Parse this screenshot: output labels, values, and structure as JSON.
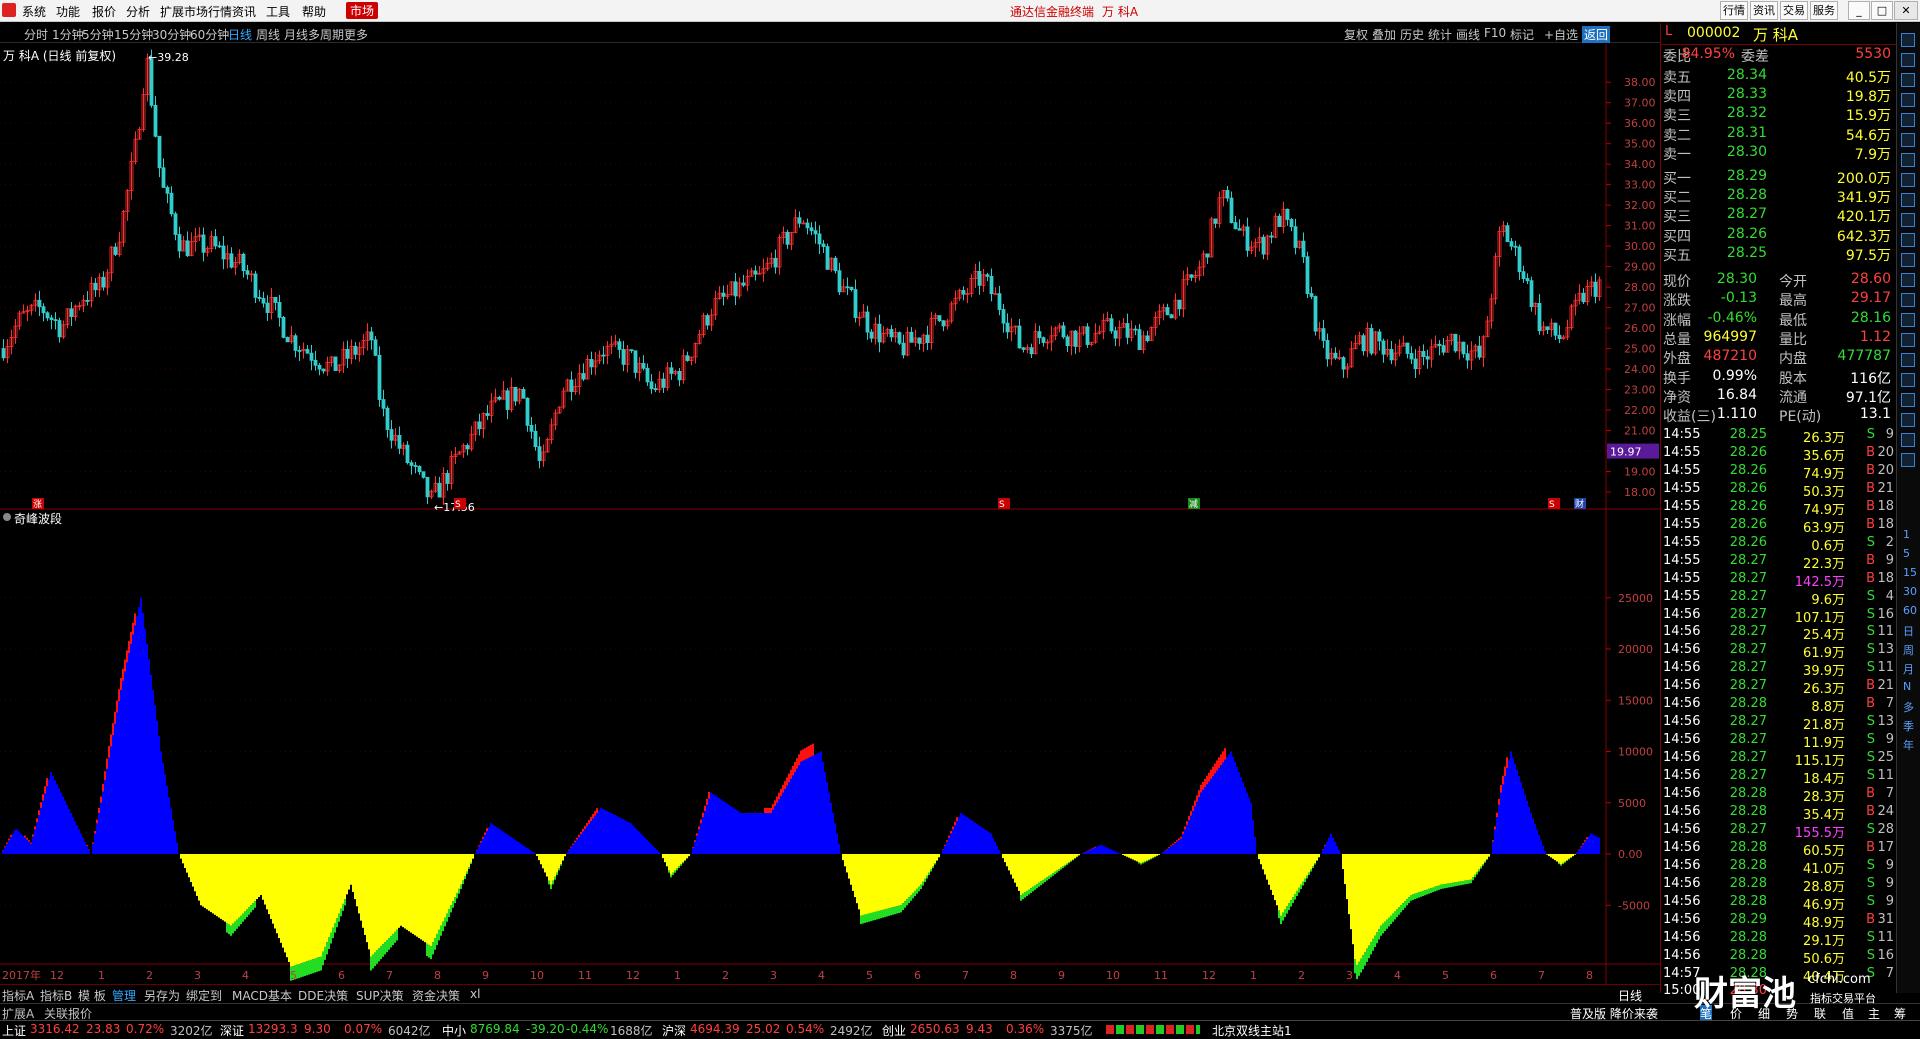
{
  "app": {
    "title": "通达信金融终端",
    "stock_title": "万 科A",
    "menu": [
      "系统",
      "功能",
      "报价",
      "分析",
      "扩展市场行情",
      "资讯",
      "工具",
      "帮助"
    ],
    "active_menu": "市场",
    "right_buttons": [
      "行情",
      "资讯",
      "交易",
      "服务"
    ]
  },
  "periods": {
    "items": [
      "分时",
      "1分钟",
      "5分钟",
      "15分钟",
      "30分钟",
      "60分钟",
      "日线",
      "周线",
      "月线",
      "多周期",
      "更多"
    ],
    "active": "日线",
    "right": [
      "复权",
      "叠加",
      "历史",
      "统计",
      "画线",
      "F10",
      "标记",
      "+自选",
      "返回"
    ]
  },
  "chart": {
    "label": "万 科A (日线 前复权)",
    "high_label": "39.28",
    "low_label": "17.56",
    "current_price_tag": "19.97",
    "price_axis": [
      "38.00",
      "37.00",
      "36.00",
      "35.00",
      "34.00",
      "33.00",
      "32.00",
      "31.00",
      "30.00",
      "29.00",
      "28.00",
      "27.00",
      "26.00",
      "25.00",
      "24.00",
      "23.00",
      "22.00",
      "21.00",
      "20.00",
      "19.00",
      "18.00"
    ],
    "markers": [
      "涨",
      "S",
      "S",
      "减",
      "S",
      "财"
    ]
  },
  "indicator": {
    "name": "奇峰波段",
    "axis": [
      "25000",
      "20000",
      "15000",
      "10000",
      "5000",
      "0.00",
      "-5000"
    ]
  },
  "time_axis": [
    "2017年",
    "12",
    "1",
    "2",
    "3",
    "4",
    "5",
    "6",
    "7",
    "8",
    "9",
    "10",
    "11",
    "12",
    "1",
    "2",
    "3",
    "4",
    "5",
    "6",
    "7",
    "8",
    "9",
    "10",
    "11",
    "12",
    "1",
    "2",
    "3",
    "4",
    "5",
    "6",
    "7",
    "8"
  ],
  "bottom_tabs": [
    "指标A",
    "指标B",
    "模 板",
    "管理",
    "另存为",
    "绑定到",
    "MACD基本",
    "DDE决策",
    "SUP决策",
    "资金决策",
    "xl"
  ],
  "bottom_period": "日线",
  "row2": {
    "left": [
      "扩展A",
      "关联报价"
    ],
    "right": [
      "普及版 降价来袭",
      "笔",
      "价",
      "细",
      "势",
      "联",
      "值",
      "主",
      "筹"
    ]
  },
  "quote": {
    "code": "000002",
    "name": "万 科A",
    "weibi_label": "委比",
    "weibi": "84.95%",
    "weicha_label": "委差",
    "weicha": "5530",
    "sells": [
      {
        "l": "卖五",
        "p": "28.34",
        "v": "40.5万"
      },
      {
        "l": "卖四",
        "p": "28.33",
        "v": "19.8万"
      },
      {
        "l": "卖三",
        "p": "28.32",
        "v": "15.9万"
      },
      {
        "l": "卖二",
        "p": "28.31",
        "v": "54.6万"
      },
      {
        "l": "卖一",
        "p": "28.30",
        "v": "7.9万"
      }
    ],
    "buys": [
      {
        "l": "买一",
        "p": "28.29",
        "v": "200.0万"
      },
      {
        "l": "买二",
        "p": "28.28",
        "v": "341.9万"
      },
      {
        "l": "买三",
        "p": "28.27",
        "v": "420.1万"
      },
      {
        "l": "买四",
        "p": "28.26",
        "v": "642.3万"
      },
      {
        "l": "买五",
        "p": "28.25",
        "v": "97.5万"
      }
    ],
    "stats": [
      [
        "现价",
        "28.30",
        "今开",
        "28.60"
      ],
      [
        "涨跌",
        "-0.13",
        "最高",
        "29.17"
      ],
      [
        "涨幅",
        "-0.46%",
        "最低",
        "28.16"
      ],
      [
        "总量",
        "964997",
        "量比",
        "1.12"
      ],
      [
        "外盘",
        "487210",
        "内盘",
        "477787"
      ],
      [
        "换手",
        "0.99%",
        "股本",
        "116亿"
      ],
      [
        "净资",
        "16.84",
        "流通",
        "97.1亿"
      ],
      [
        "收益(三)",
        "1.110",
        "PE(动)",
        "13.1"
      ]
    ],
    "ticks": [
      [
        "14:55",
        "28.25",
        "26.3万",
        "S",
        "9"
      ],
      [
        "14:55",
        "28.26",
        "35.6万",
        "B",
        "20"
      ],
      [
        "14:55",
        "28.26",
        "74.9万",
        "B",
        "20"
      ],
      [
        "14:55",
        "28.26",
        "50.3万",
        "B",
        "21"
      ],
      [
        "14:55",
        "28.26",
        "74.9万",
        "B",
        "18"
      ],
      [
        "14:55",
        "28.26",
        "63.9万",
        "B",
        "18"
      ],
      [
        "14:55",
        "28.26",
        "0.6万",
        "S",
        "2"
      ],
      [
        "14:55",
        "28.27",
        "22.3万",
        "B",
        "9"
      ],
      [
        "14:55",
        "28.27",
        "142.5万",
        "B",
        "18"
      ],
      [
        "14:55",
        "28.27",
        "9.6万",
        "S",
        "4"
      ],
      [
        "14:56",
        "28.27",
        "107.1万",
        "S",
        "16"
      ],
      [
        "14:56",
        "28.27",
        "25.4万",
        "S",
        "11"
      ],
      [
        "14:56",
        "28.27",
        "61.9万",
        "S",
        "13"
      ],
      [
        "14:56",
        "28.27",
        "39.9万",
        "S",
        "11"
      ],
      [
        "14:56",
        "28.27",
        "26.3万",
        "B",
        "21"
      ],
      [
        "14:56",
        "28.28",
        "8.8万",
        "B",
        "7"
      ],
      [
        "14:56",
        "28.27",
        "21.8万",
        "S",
        "13"
      ],
      [
        "14:56",
        "28.27",
        "11.9万",
        "S",
        "9"
      ],
      [
        "14:56",
        "28.27",
        "115.1万",
        "S",
        "25"
      ],
      [
        "14:56",
        "28.27",
        "18.4万",
        "S",
        "11"
      ],
      [
        "14:56",
        "28.28",
        "28.3万",
        "B",
        "7"
      ],
      [
        "14:56",
        "28.28",
        "35.4万",
        "B",
        "24"
      ],
      [
        "14:56",
        "28.27",
        "155.5万",
        "S",
        "28"
      ],
      [
        "14:56",
        "28.28",
        "60.5万",
        "B",
        "17"
      ],
      [
        "14:56",
        "28.28",
        "41.0万",
        "S",
        "9"
      ],
      [
        "14:56",
        "28.28",
        "28.8万",
        "S",
        "9"
      ],
      [
        "14:56",
        "28.28",
        "46.9万",
        "S",
        "9"
      ],
      [
        "14:56",
        "28.29",
        "48.9万",
        "B",
        "31"
      ],
      [
        "14:56",
        "28.28",
        "29.1万",
        "S",
        "11"
      ],
      [
        "14:56",
        "28.28",
        "50.6万",
        "S",
        "16"
      ],
      [
        "14:57",
        "28.28",
        "40.4万",
        "S",
        "7"
      ],
      [
        "15:00",
        "28.30",
        "",
        "",
        ""
      ]
    ]
  },
  "toolbar_glyphs": [
    "1",
    "5",
    "15",
    "30",
    "60",
    "日",
    "周",
    "月",
    "N",
    "多",
    "季",
    "年"
  ],
  "status": [
    {
      "name": "上证",
      "v": "3316.42",
      "c": "23.83",
      "p": "0.72%",
      "a": "3202亿"
    },
    {
      "name": "深证",
      "v": "13293.3",
      "c": "9.30",
      "p": "0.07%",
      "a": "6042亿"
    },
    {
      "name": "中小",
      "v": "8769.84",
      "c": "-39.20",
      "p": "-0.44%",
      "a": "1688亿"
    },
    {
      "name": "沪深",
      "v": "4694.39",
      "c": "25.02",
      "p": "0.54%",
      "a": "2492亿"
    },
    {
      "name": "创业",
      "v": "2650.63",
      "c": "9.43",
      "p": "0.36%",
      "a": "3375亿"
    }
  ],
  "server": "北京双线主站1",
  "watermark": {
    "brand": "财富池",
    "site": "cfchi.com",
    "slogan": "指标交易平台"
  }
}
